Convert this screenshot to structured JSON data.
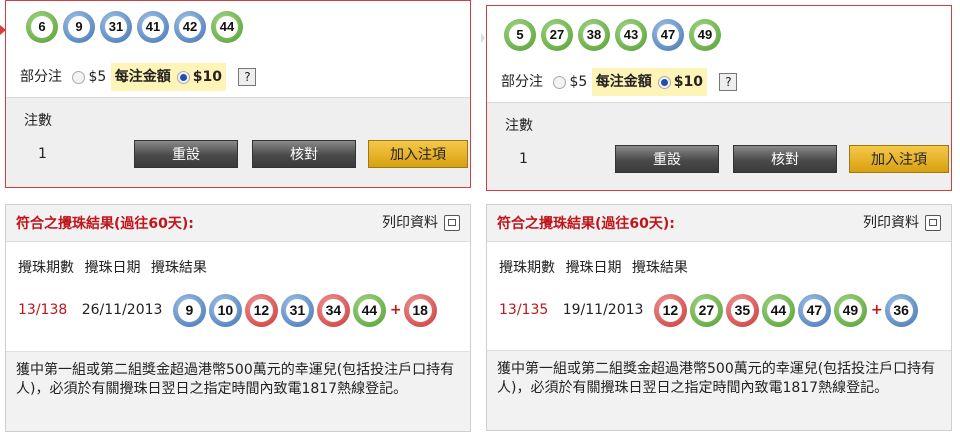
{
  "left": {
    "balls": [
      {
        "n": "6",
        "c": "green"
      },
      {
        "n": "9",
        "c": "blue"
      },
      {
        "n": "31",
        "c": "blue"
      },
      {
        "n": "41",
        "c": "blue"
      },
      {
        "n": "42",
        "c": "blue"
      },
      {
        "n": "44",
        "c": "green"
      }
    ],
    "partial_label": "部分注",
    "opt5": "$5",
    "unit_label": "每注金額",
    "opt10": "$10",
    "help": "?",
    "count_label": "注數",
    "count_value": "1",
    "reset": "重設",
    "check": "核對",
    "add": "加入注項",
    "result_title": "符合之攪珠結果(過往60天):",
    "print_label": "列印資料",
    "col1": "攪珠期數",
    "col2": "攪珠日期",
    "col3": "攪珠結果",
    "draw_no": "13/138",
    "draw_date": "26/11/2013",
    "draw_balls": [
      {
        "n": "9",
        "c": "blue"
      },
      {
        "n": "10",
        "c": "blue"
      },
      {
        "n": "12",
        "c": "red"
      },
      {
        "n": "31",
        "c": "blue"
      },
      {
        "n": "34",
        "c": "red"
      },
      {
        "n": "44",
        "c": "green"
      }
    ],
    "plus": "+",
    "extra": {
      "n": "18",
      "c": "red"
    },
    "note": "獲中第一組或第二組獎金超過港幣500萬元的幸運兒(包括投注戶口持有人)，必須於有關攪珠日翌日之指定時間內致電1817熱線登記。"
  },
  "right": {
    "balls": [
      {
        "n": "5",
        "c": "green"
      },
      {
        "n": "27",
        "c": "green"
      },
      {
        "n": "38",
        "c": "green"
      },
      {
        "n": "43",
        "c": "green"
      },
      {
        "n": "47",
        "c": "blue"
      },
      {
        "n": "49",
        "c": "green"
      }
    ],
    "partial_label": "部分注",
    "opt5": "$5",
    "unit_label": "每注金額",
    "opt10": "$10",
    "help": "?",
    "count_label": "注數",
    "count_value": "1",
    "reset": "重設",
    "check": "核對",
    "add": "加入注項",
    "result_title": "符合之攪珠結果(過往60天):",
    "print_label": "列印資料",
    "col1": "攪珠期數",
    "col2": "攪珠日期",
    "col3": "攪珠結果",
    "draw_no": "13/135",
    "draw_date": "19/11/2013",
    "draw_balls": [
      {
        "n": "12",
        "c": "red"
      },
      {
        "n": "27",
        "c": "green"
      },
      {
        "n": "35",
        "c": "red"
      },
      {
        "n": "44",
        "c": "green"
      },
      {
        "n": "47",
        "c": "blue"
      },
      {
        "n": "49",
        "c": "green"
      }
    ],
    "plus": "+",
    "extra": {
      "n": "36",
      "c": "blue"
    },
    "note": "獲中第一組或第二組獎金超過港幣500萬元的幸運兒(包括投注戶口持有人)，必須於有關攪珠日翌日之指定時間內致電1817熱線登記。"
  }
}
